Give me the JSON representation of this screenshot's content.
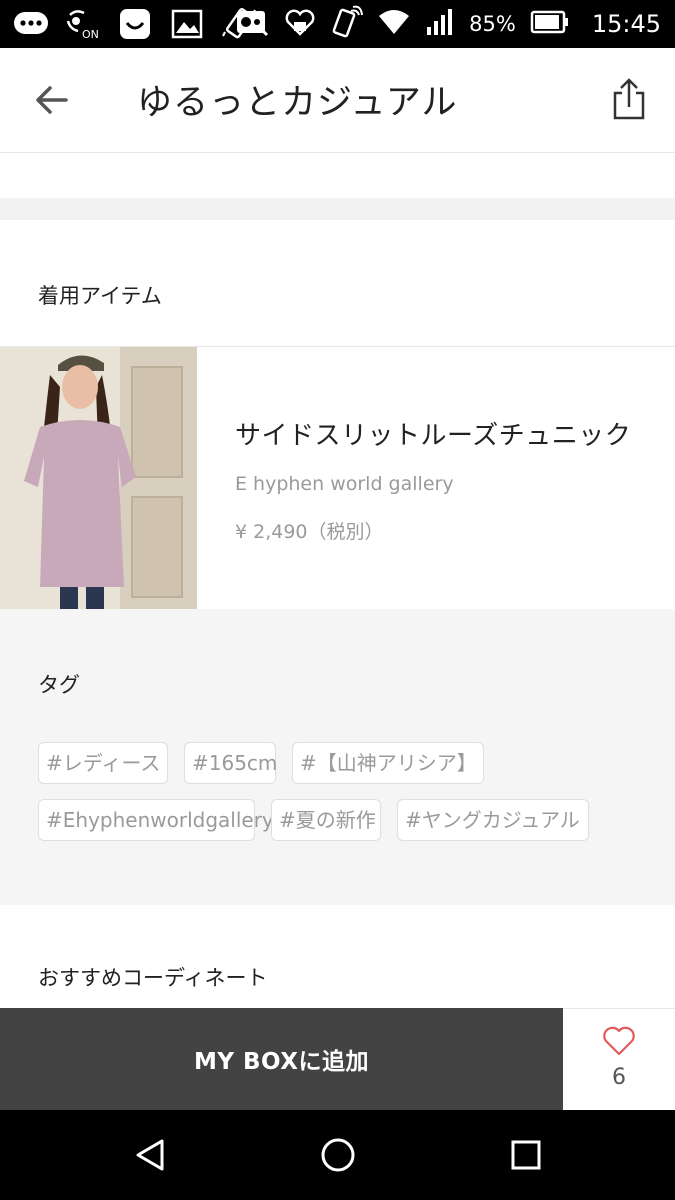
{
  "status_bar": {
    "battery_percent": "85%",
    "time": "15:45",
    "icons": [
      "chat-bubble-icon",
      "nfc-on-icon",
      "smiley-icon",
      "image-icon",
      "phone-vibrate-icon",
      "mobile-pay-icon",
      "heart-box-icon",
      "nfc-icon",
      "wifi-icon",
      "signal-icon",
      "battery-icon"
    ]
  },
  "header": {
    "title": "ゆるっとカジュアル",
    "back_icon": "back-arrow-icon",
    "share_icon": "share-icon"
  },
  "items": {
    "heading": "着用アイテム",
    "list": [
      {
        "name": "サイドスリットルーズチュニック",
        "brand": "E hyphen world gallery",
        "price": "¥ 2,490（税別）"
      }
    ]
  },
  "tags": {
    "heading": "タグ",
    "list": [
      "#レディース",
      "#165cm",
      "#【山神アリシア】",
      "#Ehyphenworldgallery",
      "#夏の新作",
      "#ヤングカジュアル"
    ]
  },
  "recommend": {
    "heading": "おすすめコーディネート"
  },
  "action_bar": {
    "add_label": "MY BOXに追加",
    "like_count": "6",
    "like_color": "#e25b5b"
  },
  "colors": {
    "action_button": "#434343",
    "tag_text": "#9a9a9a",
    "section_bg": "#f5f5f5"
  }
}
